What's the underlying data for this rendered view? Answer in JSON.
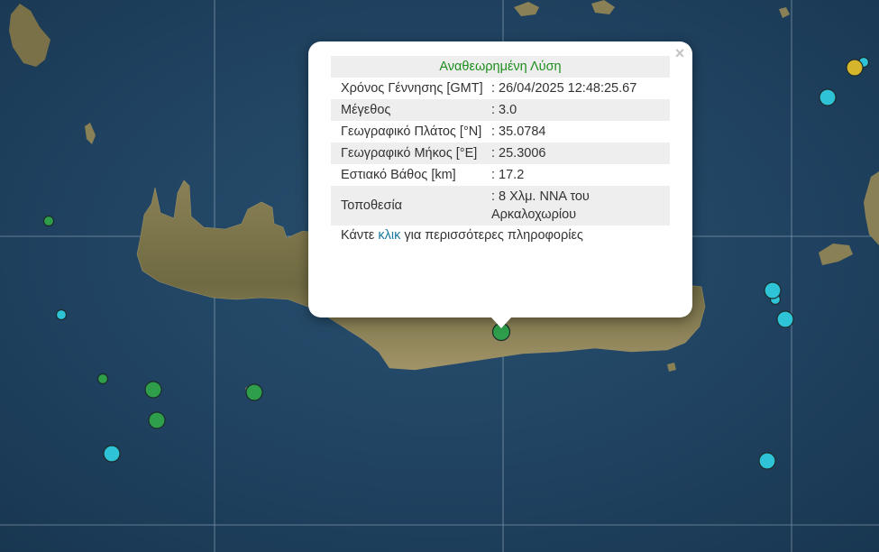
{
  "popup": {
    "header": "Αναθεωρημένη Λύση",
    "close_label": "×",
    "rows": [
      {
        "label": "Χρόνος Γέννησης [GMT]",
        "value": ": 26/04/2025 12:48:25.67"
      },
      {
        "label": "Μέγεθος",
        "value": ": 3.0"
      },
      {
        "label": "Γεωγραφικό Πλάτος [°N]",
        "value": ": 35.0784"
      },
      {
        "label": "Γεωγραφικό Μήκος [°E]",
        "value": ": 25.3006"
      },
      {
        "label": "Εστιακό Βάθος [km]",
        "value": ": 17.2"
      },
      {
        "label": "Τοποθεσία",
        "value": ": 8 Χλμ. ΝΝΑ του Αρκαλοχωρίου"
      }
    ],
    "footer": {
      "before": "Κάντε ",
      "link": "κλικ",
      "after": " για περισσότερες πληροφορίες"
    }
  },
  "map": {
    "sea_color": "#1f3f5c",
    "land_color": "#7b7148",
    "grid_color": "#c9d6e3",
    "quake_colors": {
      "green": "#2e9e4a",
      "cyan": "#2ec3d6",
      "yellow": "#d4b52c"
    }
  }
}
